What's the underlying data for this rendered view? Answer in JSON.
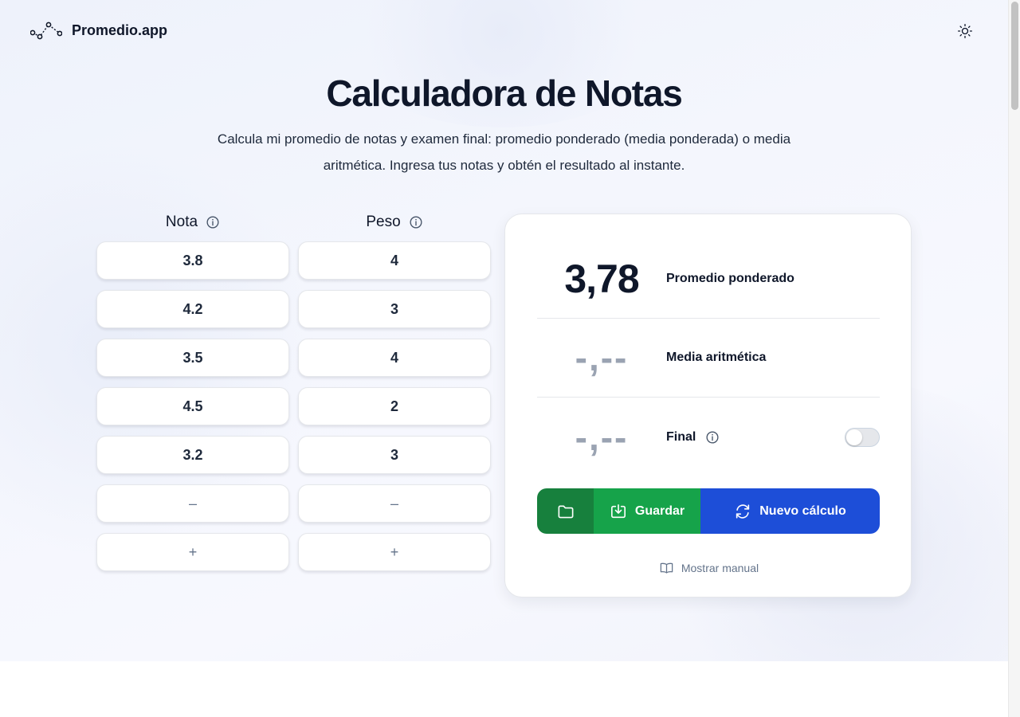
{
  "header": {
    "brand": "Promedio.app",
    "theme_icon": "sun-icon",
    "logo_icon": "line-chart-logo-icon"
  },
  "hero": {
    "title": "Calculadora de Notas",
    "subtitle_line1": "Calcula mi promedio de notas y examen final: promedio ponderado (media ponderada) o media",
    "subtitle_line2": "aritmética. Ingresa tus notas y obtén el resultado al instante."
  },
  "table": {
    "nota_header": "Nota",
    "peso_header": "Peso",
    "notas": [
      "3.8",
      "4.2",
      "3.5",
      "4.5",
      "3.2"
    ],
    "pesos": [
      "4",
      "3",
      "4",
      "2",
      "3"
    ],
    "remove_label": "–",
    "add_label": "+"
  },
  "results": {
    "weighted_value": "3,78",
    "weighted_label": "Promedio ponderado",
    "arithmetic_value": "-,--",
    "arithmetic_label": "Media aritmética",
    "final_value": "-,--",
    "final_label": "Final",
    "final_toggle_on": false
  },
  "actions": {
    "save_label": "Guardar",
    "new_label": "Nuevo cálculo",
    "manual_label": "Mostrar manual"
  },
  "colors": {
    "folder_button": "#17803d",
    "save_button": "#16a34a",
    "new_button": "#1d4ed8",
    "text": "#0f172a"
  }
}
